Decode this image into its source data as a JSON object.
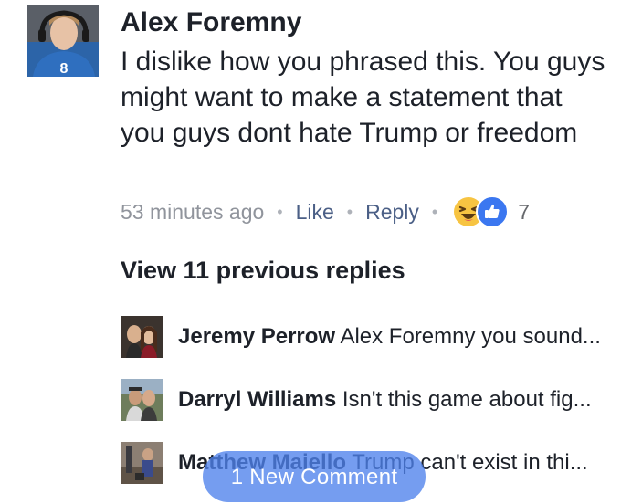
{
  "comment": {
    "author": "Alex Foremny",
    "text": "I dislike how you phrased this.  You guys might want to make a statement that you guys dont hate Trump or freedom",
    "time": "53 minutes ago",
    "like_label": "Like",
    "reply_label": "Reply",
    "separator": "•",
    "reactions": [
      "haha-reaction-icon",
      "like-reaction-icon"
    ],
    "reaction_count": "7"
  },
  "replies": {
    "view_previous": "View 11 previous replies",
    "items": [
      {
        "name": "Jeremy Perrow",
        "text": "Alex Foremny you sound..."
      },
      {
        "name": "Darryl Williams",
        "text": "Isn't this game about fig..."
      },
      {
        "name": "Matthew Maiello",
        "text": "Trump can't exist in thi..."
      }
    ]
  },
  "new_comment_pill": "1 New Comment",
  "colors": {
    "link": "#4b5f86",
    "meta": "#90949c",
    "like_blue": "#3b77f0",
    "haha_yellow": "#f7c442",
    "pill": "#4e82ec"
  }
}
